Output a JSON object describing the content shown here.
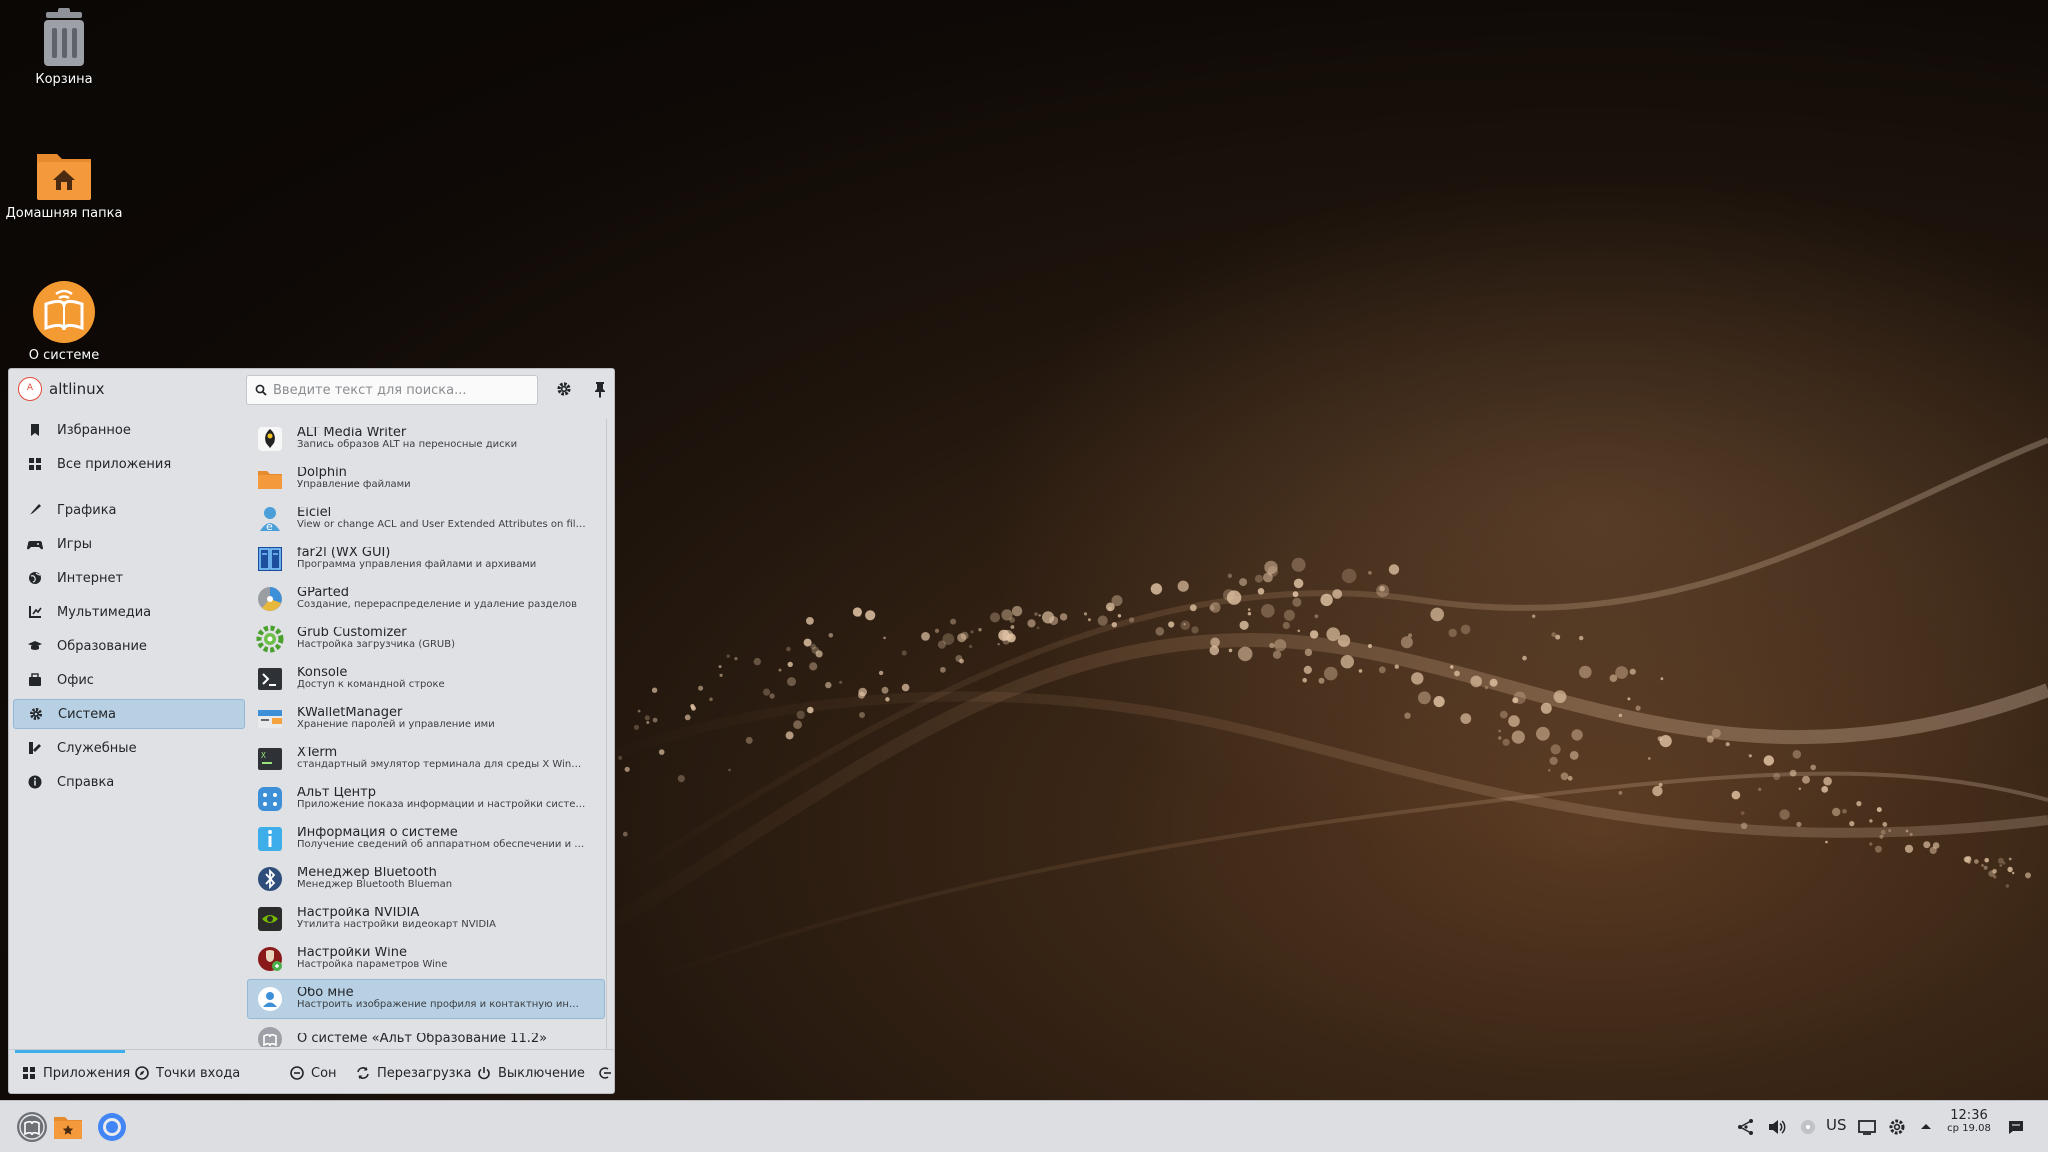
{
  "desktop": {
    "icons": [
      {
        "label": "Корзина",
        "icon": "trash-icon"
      },
      {
        "label": "Домашняя папка",
        "icon": "home-folder-icon"
      },
      {
        "label": "О системе",
        "icon": "about-system-icon"
      }
    ]
  },
  "launcher": {
    "username": "altlinux",
    "avatar_letter": "A",
    "search_placeholder": "Введите текст для поиска...",
    "categories": [
      {
        "label": "Избранное",
        "icon": "bookmark-icon"
      },
      {
        "label": "Все приложения",
        "icon": "grid-icon"
      },
      {
        "label": "Графика",
        "icon": "graphics-icon"
      },
      {
        "label": "Игры",
        "icon": "gamepad-icon"
      },
      {
        "label": "Интернет",
        "icon": "globe-icon"
      },
      {
        "label": "Мультимедиа",
        "icon": "multimedia-icon"
      },
      {
        "label": "Образование",
        "icon": "education-icon"
      },
      {
        "label": "Офис",
        "icon": "office-icon"
      },
      {
        "label": "Система",
        "icon": "gear-icon",
        "selected": true
      },
      {
        "label": "Служебные",
        "icon": "utilities-icon"
      },
      {
        "label": "Справка",
        "icon": "help-icon"
      }
    ],
    "apps": [
      {
        "name": "ALT Media Writer",
        "desc": "Запись образов ALT на переносные диски"
      },
      {
        "name": "Dolphin",
        "desc": "Управление файлами"
      },
      {
        "name": "Eiciel",
        "desc": "View or change ACL and User Extended Attributes on file…"
      },
      {
        "name": "far2l (WX GUI)",
        "desc": "Программа управления файлами и архивами"
      },
      {
        "name": "GParted",
        "desc": "Создание, перераспределение и удаление разделов"
      },
      {
        "name": "Grub Customizer",
        "desc": "Настройка загрузчика (GRUB)"
      },
      {
        "name": "Konsole",
        "desc": "Доступ к командной строке"
      },
      {
        "name": "KWalletManager",
        "desc": "Хранение паролей и управление ими"
      },
      {
        "name": "XTerm",
        "desc": "стандартный эмулятор терминала для среды X Windo…"
      },
      {
        "name": "Альт Центр",
        "desc": "Приложение показа информации и настройки системы"
      },
      {
        "name": "Информация о системе",
        "desc": "Получение сведений об аппаратном обеспечении и с…"
      },
      {
        "name": "Менеджер Bluetooth",
        "desc": "Менеджер Bluetooth Blueman"
      },
      {
        "name": "Настройка NVIDIA",
        "desc": "Утилита настройки видеокарт NVIDIA"
      },
      {
        "name": "Настройки Wine",
        "desc": "Настройка параметров Wine"
      },
      {
        "name": "Обо мне",
        "desc": "Настроить изображение профиля и контактную инфо…",
        "selected": true
      },
      {
        "name": "О системе «Альт Образование 11.2»",
        "desc": ""
      }
    ],
    "footer": {
      "applications": "Приложения",
      "places": "Точки входа",
      "sleep": "Сон",
      "restart": "Перезагрузка",
      "shutdown": "Выключение"
    }
  },
  "taskbar": {
    "keyboard_layout": "US",
    "time": "12:36",
    "date": "ср 19.08"
  },
  "colors": {
    "accent": "#3daee9",
    "selection": "#b7d0e3",
    "panel": "#dcdee2"
  }
}
